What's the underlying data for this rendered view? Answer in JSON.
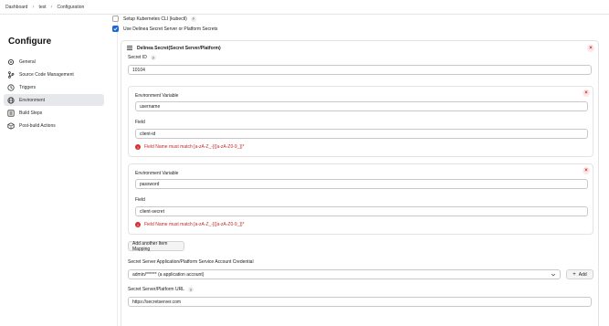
{
  "breadcrumb": [
    "Dashboard",
    "test",
    "Configuration"
  ],
  "sidebar": {
    "title": "Configure",
    "items": [
      {
        "label": "General",
        "icon": "gear-icon"
      },
      {
        "label": "Source Code Management",
        "icon": "branch-icon"
      },
      {
        "label": "Triggers",
        "icon": "clock-icon"
      },
      {
        "label": "Environment",
        "icon": "globe-icon",
        "active": true
      },
      {
        "label": "Build Steps",
        "icon": "list-icon"
      },
      {
        "label": "Post-build Actions",
        "icon": "cube-icon"
      }
    ]
  },
  "options": {
    "k8s_label": "Setup Kubernetes CLI (kubectl)",
    "delinea_label": "Use Delinea Secret Server or Platform Secrets"
  },
  "card": {
    "title": "Delinea Secret(Secret Server/Platform)",
    "secret_id_label": "Secret ID",
    "secret_id_value": "10104"
  },
  "mappings": [
    {
      "env_label": "Environment Variable",
      "env_value": "username",
      "field_label": "Field",
      "field_value": "client-id",
      "error": "Field Name must match [a-zA-Z_-]([a-zA-Z0-9_])*"
    },
    {
      "env_label": "Environment Variable",
      "env_value": "password",
      "field_label": "Field",
      "field_value": "client-secret",
      "error": "Field Name must match [a-zA-Z_-]([a-zA-Z0-9_])*"
    }
  ],
  "add_mapping_label": "Add another Item Mapping",
  "credential": {
    "label": "Secret Server Application/Platform Service Account Credential",
    "value": "admin/****** (a application account)",
    "add_label": "Add"
  },
  "url": {
    "label": "Secret Server/Platform URL",
    "value": "https://secretserver.com"
  },
  "colors": {
    "accent": "#1a66d6",
    "error": "#c62828",
    "active_nav": "#e7e8ec"
  }
}
